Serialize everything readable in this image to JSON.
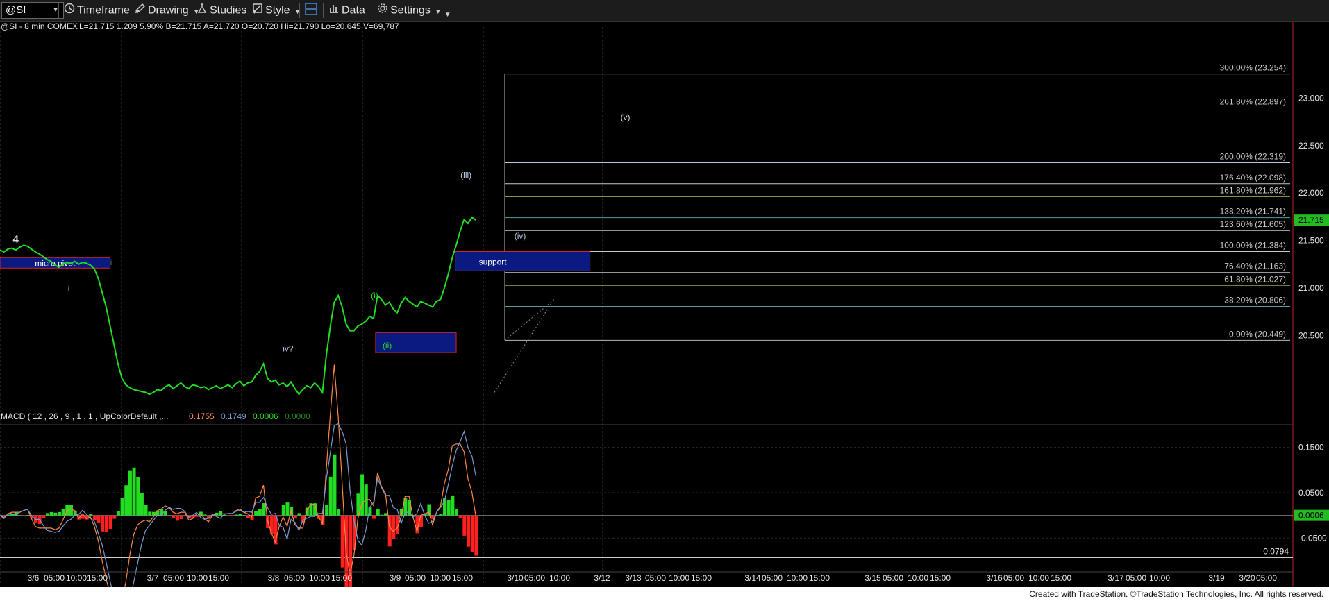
{
  "toolbar": {
    "symbol": "@SI",
    "timeframe_label": "Timeframe",
    "drawing_label": "Drawing",
    "studies_label": "Studies",
    "style_label": "Style",
    "data_label": "Data",
    "settings_label": "Settings"
  },
  "footer": {
    "credit": "Created with TradeStation. ©TradeStation Technologies, Inc. All rights reserved."
  },
  "chart_data": {
    "type": "line",
    "header": {
      "symbol": "@SI - 8 min  COMEX",
      "quote": "L=21.715  1.209  5.90%  B=21.715  A=21.720  O=20.720  Hi=21.790  Lo=20.645  V=69,787"
    },
    "last_price": 21.715,
    "price_ylim": [
      19.75,
      23.5
    ],
    "price_ticks": [
      20.5,
      21.0,
      21.5,
      22.0,
      22.5,
      23.0
    ],
    "price_tick_labels": [
      "20.500",
      "21.000",
      "21.500",
      "22.000",
      "22.500",
      "23.000"
    ],
    "last_price_label": "21.715",
    "x_tick_labels": [
      "3/6",
      "05:00",
      "10:00",
      "15:00",
      "3/7",
      "05:00",
      "10:00",
      "15:00",
      "3/8",
      "05:00",
      "10:00",
      "15:00",
      "3/9",
      "05:00",
      "10:00",
      "15:00",
      "3/10",
      "05:00",
      "10:00",
      "3/12",
      "3/13",
      "05:00",
      "10:00",
      "15:00",
      "3/14",
      "05:00",
      "10:00",
      "15:00",
      "3/15",
      "05:00",
      "10:00",
      "15:00",
      "3/16",
      "05:00",
      "10:00",
      "15:00",
      "3/17",
      "05:00",
      "10:00",
      "3/19",
      "3/20",
      "05:00"
    ],
    "price_series": {
      "color": "#22dd22",
      "x": [
        0,
        0.4,
        0.8,
        1.2,
        1.6,
        2.0,
        2.4,
        2.8,
        3.2,
        3.6,
        4.0,
        4.4,
        4.8,
        5.2,
        5.6,
        6.0,
        6.4,
        6.8,
        7.2,
        7.6,
        8.0,
        8.4,
        8.8,
        9.2,
        9.6,
        10.0,
        10.4,
        10.8,
        11.2,
        11.6,
        12.0,
        12.4,
        12.8,
        13.2,
        13.6,
        14.0,
        14.4,
        14.8,
        15.2,
        15.6,
        16.0,
        16.4,
        16.8,
        17.2,
        17.6,
        18.0,
        18.4,
        18.8,
        19.2,
        19.6,
        20.0,
        20.4,
        20.8,
        21.2,
        21.6,
        22.0,
        22.4,
        22.8,
        23.2,
        23.6,
        24.0,
        24.4,
        24.8,
        25.2,
        25.6,
        26.0,
        26.4,
        26.8,
        27.2,
        27.6,
        28.0,
        28.4,
        28.8,
        29.2,
        29.6,
        30.0,
        30.4,
        30.8,
        31.2,
        31.6,
        32.0,
        32.4,
        32.8,
        33.2,
        33.6,
        34.0,
        34.4,
        34.8,
        35.2,
        35.6,
        36.0,
        36.4,
        36.8,
        37.2,
        37.6,
        38.0,
        38.4,
        38.8,
        39.2,
        39.6,
        40.0,
        40.4,
        40.8,
        41.2,
        41.6,
        42.0,
        42.4,
        42.8,
        43.2,
        43.6,
        44.0,
        44.4,
        44.8,
        45.2,
        45.6,
        46.0,
        46.4,
        46.8,
        47.2,
        47.6,
        48.0,
        48.4,
        48.8,
        49.2,
        49.6,
        50.0,
        50.4,
        50.8,
        51.2,
        51.6,
        52.0,
        52.4,
        52.8,
        53.2,
        53.6,
        54.0,
        54.4,
        54.8,
        55.2,
        55.6,
        56.0,
        56.4,
        56.8
      ],
      "y": [
        21.4,
        21.38,
        21.41,
        21.42,
        21.4,
        21.43,
        21.45,
        21.44,
        21.41,
        21.38,
        21.36,
        21.33,
        21.3,
        21.28,
        21.24,
        21.22,
        21.25,
        21.27,
        21.26,
        21.28,
        21.25,
        21.27,
        21.26,
        21.24,
        21.2,
        21.1,
        20.95,
        20.8,
        20.6,
        20.4,
        20.2,
        20.05,
        19.98,
        19.95,
        19.93,
        19.92,
        19.91,
        19.9,
        19.88,
        19.9,
        19.93,
        19.92,
        19.96,
        19.98,
        19.94,
        19.97,
        20.0,
        19.96,
        19.94,
        19.98,
        19.97,
        19.95,
        19.96,
        19.93,
        19.95,
        19.97,
        19.94,
        19.96,
        19.98,
        19.95,
        19.99,
        20.02,
        19.97,
        20.0,
        20.01,
        20.08,
        20.12,
        20.2,
        20.05,
        20.01,
        20.03,
        19.98,
        20.0,
        19.96,
        20.01,
        19.94,
        19.88,
        19.93,
        19.97,
        19.95,
        20.0,
        19.96,
        19.9,
        20.3,
        20.6,
        20.85,
        20.92,
        20.8,
        20.62,
        20.55,
        20.55,
        20.6,
        20.62,
        20.65,
        20.7,
        20.68,
        20.92,
        20.88,
        20.82,
        20.85,
        20.78,
        20.74,
        20.84,
        20.9,
        20.86,
        20.83,
        20.8,
        20.86,
        20.84,
        20.82,
        20.8,
        20.86,
        20.88,
        21.0,
        21.15,
        21.32,
        21.45,
        21.6,
        21.72,
        21.68,
        21.745,
        21.715
      ]
    },
    "fib_levels": [
      {
        "label": "300.00% (23.254)",
        "price": 23.254,
        "color": "#b8b8b8"
      },
      {
        "label": "261.80% (22.897)",
        "price": 22.897,
        "color": "#b8b8b8"
      },
      {
        "label": "200.00% (22.319)",
        "price": 22.319,
        "color": "#b8c6e0"
      },
      {
        "label": "176.40% (22.098)",
        "price": 22.098,
        "color": "#c8c8c8"
      },
      {
        "label": "161.80% (21.962)",
        "price": 21.962,
        "color": "#a6a05a"
      },
      {
        "label": "138.20% (21.741)",
        "price": 21.741,
        "color": "#5a9aa0"
      },
      {
        "label": "123.60% (21.605)",
        "price": 21.605,
        "color": "#c8c8c8"
      },
      {
        "label": "100.00% (21.384)",
        "price": 21.384,
        "color": "#c8c8c8"
      },
      {
        "label": "76.40% (21.163)",
        "price": 21.163,
        "color": "#c8c8c8"
      },
      {
        "label": "61.80% (21.027)",
        "price": 21.027,
        "color": "#a6a05a"
      },
      {
        "label": "38.20% (20.806)",
        "price": 20.806,
        "color": "#5a9aa0"
      },
      {
        "label": "0.00% (20.449)",
        "price": 20.449,
        "color": "#b8b8b8"
      }
    ],
    "zones": [
      {
        "label": "micro pivot",
        "x0": 0,
        "x1": 11.2,
        "p_top": 21.32,
        "p_bot": 21.21
      },
      {
        "label": "support",
        "x0": 46.3,
        "x1": 60.0,
        "p_top": 21.384,
        "p_bot": 21.18
      },
      {
        "label": "(ii)",
        "x0": 38.2,
        "x1": 46.4,
        "p_top": 20.53,
        "p_bot": 20.32
      }
    ],
    "wave_labels": [
      {
        "text": "4",
        "x": 1.6,
        "price": 21.48,
        "color": "#dddddd"
      },
      {
        "text": "i",
        "x": 7.0,
        "price": 20.97,
        "color": "#b8c6e0"
      },
      {
        "text": "ii",
        "x": 11.3,
        "price": 21.24,
        "color": "#dddddd"
      },
      {
        "text": "iv?",
        "x": 29.3,
        "price": 20.33,
        "color": "#b8c6e0"
      },
      {
        "text": "(i)",
        "x": 38.1,
        "price": 20.89,
        "color": "#22dd22"
      },
      {
        "text": "(iii)",
        "x": 47.4,
        "price": 22.16,
        "color": "#b8c6e0"
      },
      {
        "text": "(iv)",
        "x": 52.9,
        "price": 21.52,
        "color": "#b8c6e0"
      },
      {
        "text": "(v)",
        "x": 63.6,
        "price": 22.77,
        "color": "#dddddd"
      }
    ],
    "macd": {
      "header": "MACD ( 12 , 26 , 9 , 1 , 1 , UpColorDefault ,...",
      "values": [
        "0.1755",
        "0.1749",
        "0.0006",
        "0.0000"
      ],
      "value_colors": [
        "#ff8844",
        "#7a9ad0",
        "#22dd22",
        "#228822"
      ],
      "ylim": [
        -0.12,
        0.2
      ],
      "ticks": [
        0.15,
        0.05,
        -0.05
      ],
      "tick_labels": [
        "0.1500",
        "0.0500",
        "-0.0500"
      ],
      "marker_label": "-0.0794",
      "marker_value": -0.0794,
      "current_label": "0.0006"
    }
  }
}
